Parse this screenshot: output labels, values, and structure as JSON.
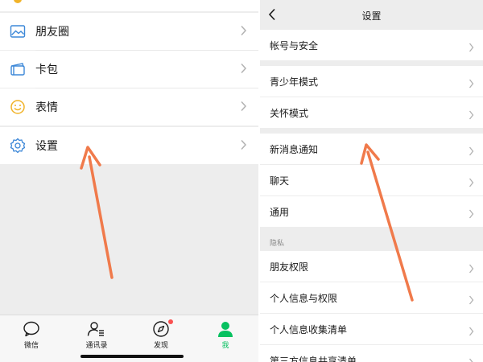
{
  "left_menu": {
    "items": [
      {
        "label": "朋友圈",
        "icon": "moments-icon"
      },
      {
        "label": "卡包",
        "icon": "card-package-icon"
      },
      {
        "label": "表情",
        "icon": "sticker-smile-icon"
      },
      {
        "label": "设置",
        "icon": "gear-icon"
      }
    ]
  },
  "tabbar": {
    "tabs": [
      {
        "label": "微信",
        "icon": "chat-bubble-icon",
        "active": false
      },
      {
        "label": "通讯录",
        "icon": "contacts-icon",
        "active": false
      },
      {
        "label": "发现",
        "icon": "compass-icon",
        "active": false,
        "badge": true
      },
      {
        "label": "我",
        "icon": "person-icon",
        "active": true
      }
    ],
    "active_color": "#07c160"
  },
  "settings": {
    "title": "设置",
    "groups": [
      {
        "items": [
          "帐号与安全"
        ]
      },
      {
        "items": [
          "青少年模式",
          "关怀模式"
        ]
      },
      {
        "items": [
          "新消息通知",
          "聊天",
          "通用"
        ]
      },
      {
        "section": "隐私",
        "items": [
          "朋友权限",
          "个人信息与权限",
          "个人信息收集清单",
          "第三方信息共享清单"
        ]
      }
    ]
  },
  "annotation": {
    "arrow_color": "#f07a4b"
  }
}
